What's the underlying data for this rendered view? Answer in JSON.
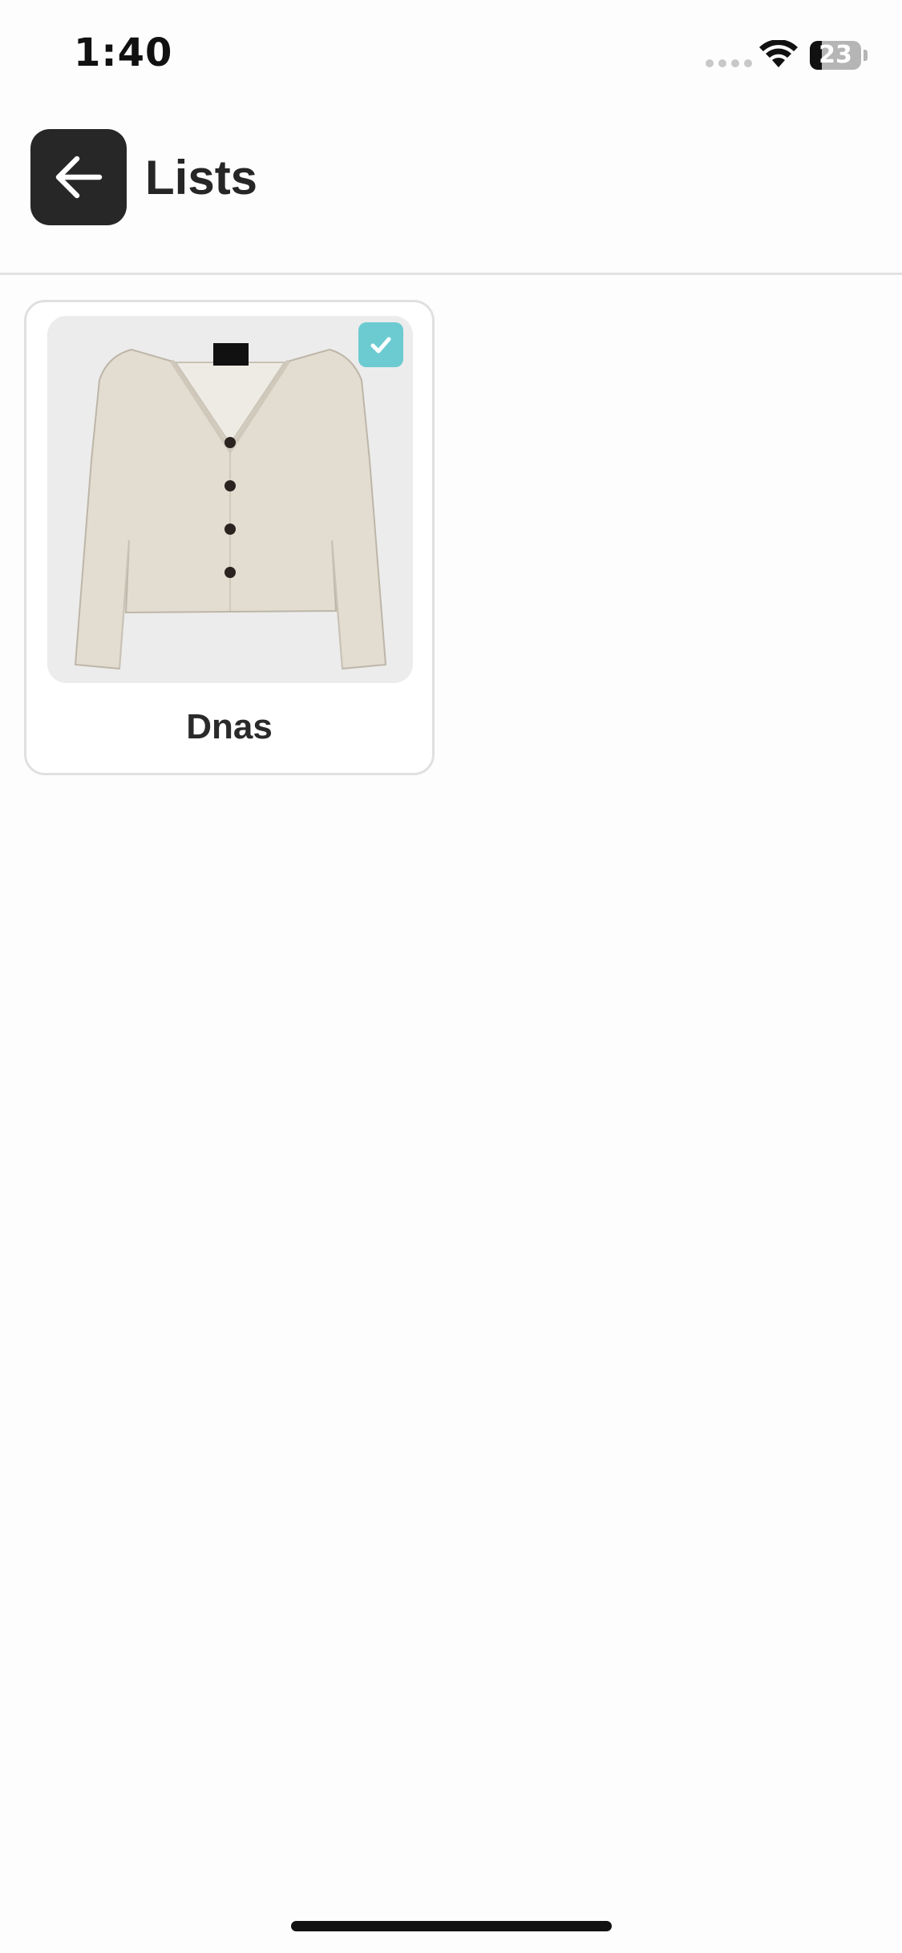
{
  "status_bar": {
    "time": "1:40",
    "battery_percent": "23",
    "battery_level": 0.23
  },
  "header": {
    "title": "Lists",
    "back_icon": "arrow-left-icon"
  },
  "lists": [
    {
      "name": "Dnas",
      "selected": true,
      "image": "beige-cardigan-jacket",
      "badge_icon": "checkmark-icon"
    }
  ],
  "colors": {
    "accent": "#6ccbd1",
    "back_button": "#272727",
    "card_border": "#e0e0e0",
    "divider": "#e2e2e2"
  }
}
